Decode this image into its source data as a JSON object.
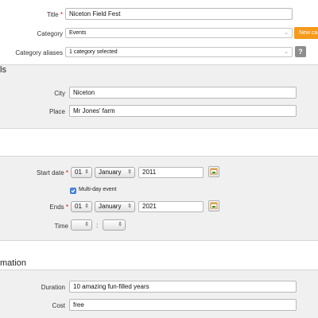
{
  "fields": {
    "title": {
      "label": "Title",
      "value": "Niceton Field Fest"
    },
    "category": {
      "label": "Category",
      "value": "Events"
    },
    "new_category_button": "New ca",
    "category_aliases": {
      "label": "Category aliases",
      "value": "1 category selected"
    },
    "help_button": "?",
    "city": {
      "label": "City",
      "value": "Niceton"
    },
    "place": {
      "label": "Place",
      "value": "Mr Jones' farm"
    },
    "start_date": {
      "label": "Start date",
      "day": "01",
      "month": "January",
      "year": "2011"
    },
    "multi_day": {
      "label": "Multi-day event",
      "checked": true
    },
    "ends": {
      "label": "Ends",
      "day": "01",
      "month": "January",
      "year": "2021"
    },
    "time": {
      "label": "Time",
      "hour": "",
      "minute": "",
      "separator": ":"
    },
    "duration": {
      "label": "Duration",
      "value": "10 amazing fun-filled years"
    },
    "cost": {
      "label": "Cost",
      "value": "free"
    }
  },
  "sections": {
    "location_heading_fragment": "ls",
    "information_heading_fragment": "mation"
  },
  "required_marker": "*",
  "icons": {
    "calendar": "calendar-icon",
    "dropdown": "chevron-down-icon",
    "spinner": "up-down-arrows-icon",
    "checkbox": "checkmark-icon"
  },
  "colors": {
    "accent_button": "#f59a1b",
    "required": "#dd0000",
    "section_background": "#f0f0f0",
    "checkbox": "#4f8ee0"
  }
}
